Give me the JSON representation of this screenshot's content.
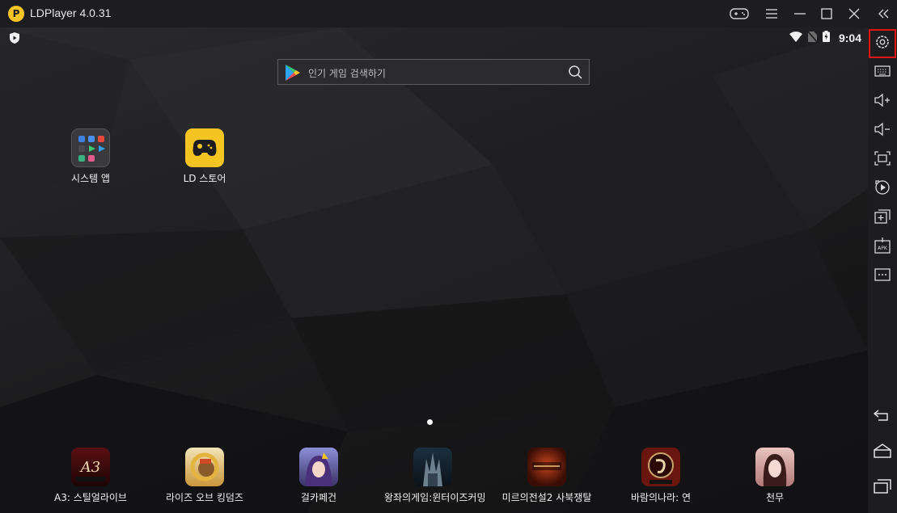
{
  "window": {
    "title": "LDPlayer 4.0.31",
    "logo_glyph": "P"
  },
  "statusbar": {
    "time": "9:04",
    "icons": [
      "shield-icon",
      "wifi-icon",
      "no-sim-icon",
      "battery-charging-icon"
    ]
  },
  "search": {
    "placeholder": "인기 게임 검색하기",
    "icon": "search-icon"
  },
  "desktop_apps": [
    {
      "label": "시스템 앱",
      "icon": "system-apps-folder-icon"
    },
    {
      "label": "LD 스토어",
      "icon": "ld-store-icon"
    }
  ],
  "dock_apps": [
    {
      "label": "A3: 스틸얼라이브",
      "icon": "a3-game-icon"
    },
    {
      "label": "라이즈 오브 킹덤즈",
      "icon": "rise-of-kingdoms-icon"
    },
    {
      "label": "걸카페건",
      "icon": "girl-cafe-gun-icon"
    },
    {
      "label": "왕좌의게임:윈터이즈커밍",
      "icon": "game-of-thrones-icon"
    },
    {
      "label": "미르의전설2 사북쟁탈",
      "icon": "legend-of-mir-icon"
    },
    {
      "label": "바람의나라: 연",
      "icon": "kingdom-of-winds-icon"
    },
    {
      "label": "천무",
      "icon": "cheonmu-icon"
    }
  ],
  "sidebar": {
    "buttons": [
      "settings-icon",
      "keyboard-icon",
      "volume-up-icon",
      "volume-down-icon",
      "fullscreen-icon",
      "record-icon",
      "multi-instance-icon",
      "apk-install-icon",
      "more-icon"
    ],
    "nav": [
      "back-icon",
      "home-icon",
      "recent-apps-icon"
    ]
  },
  "colors": {
    "accent": "#f4c522",
    "highlight": "#e01616",
    "background": "#1b1b1d"
  }
}
